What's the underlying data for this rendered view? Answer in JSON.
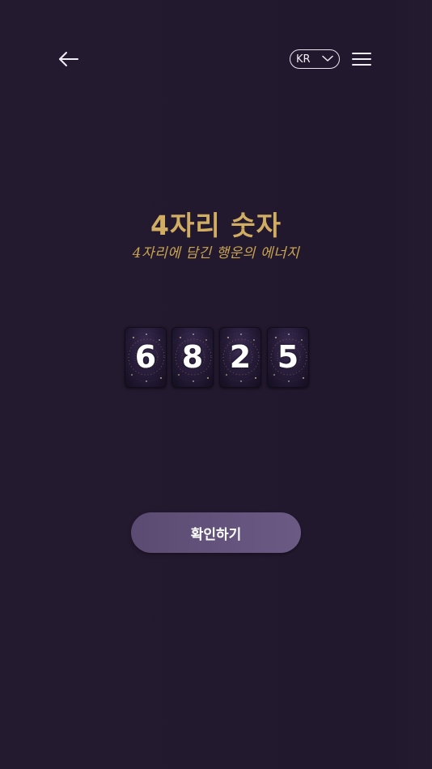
{
  "header": {
    "back_icon": "arrow-left-icon",
    "language": {
      "selected": "KR",
      "icon": "chevron-down-icon"
    },
    "menu_icon": "hamburger-menu-icon"
  },
  "main": {
    "title": "4자리 숫자",
    "subtitle": "4자리에 담긴 행운의 에너지",
    "digits": [
      "6",
      "8",
      "2",
      "5"
    ],
    "confirm_label": "확인하기"
  },
  "colors": {
    "background": "#22192e",
    "accent_gold": "#d0ad62",
    "button": "#5f4e78",
    "text_light": "#ffffff"
  }
}
